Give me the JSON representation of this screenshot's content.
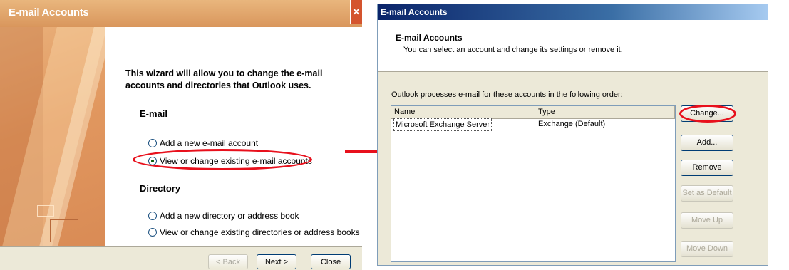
{
  "wizard": {
    "title": "E-mail Accounts",
    "intro": "This wizard will allow you to change the e-mail accounts and directories that Outlook uses.",
    "email_heading": "E-mail",
    "email_options": [
      "Add a new e-mail account",
      "View or change existing e-mail accounts"
    ],
    "directory_heading": "Directory",
    "directory_options": [
      "Add a new directory or address book",
      "View or change existing directories or address books"
    ],
    "buttons": {
      "back": "< Back",
      "next": "Next >",
      "close": "Close"
    }
  },
  "dialog": {
    "title": "E-mail Accounts",
    "heading": "E-mail Accounts",
    "subheading": "You can select an account and change its settings or remove it.",
    "order_label": "Outlook processes e-mail for these accounts in the following order:",
    "columns": [
      "Name",
      "Type"
    ],
    "accounts": [
      {
        "name": "Microsoft Exchange Server",
        "type": "Exchange (Default)"
      }
    ],
    "buttons": {
      "change": "Change...",
      "add": "Add...",
      "remove": "Remove",
      "set_default": "Set as Default",
      "move_up": "Move Up",
      "move_down": "Move Down"
    }
  },
  "colors": {
    "highlight": "#e8101c",
    "xp_title": "#0a246a",
    "wizard_title": "#d9965c"
  },
  "icons": [
    "close-icon",
    "envelope-icon",
    "arrow-icon"
  ]
}
